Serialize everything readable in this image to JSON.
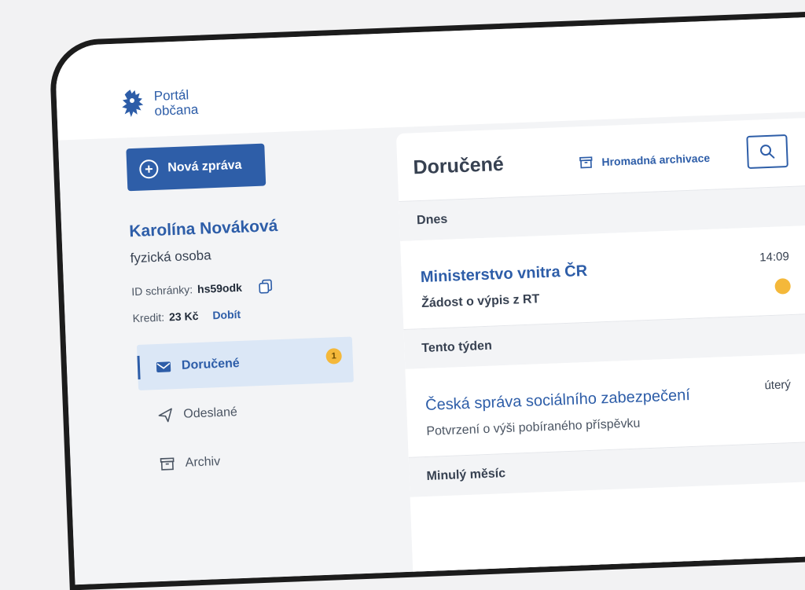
{
  "header": {
    "logo_line1": "Portál",
    "logo_line2": "občana"
  },
  "sidebar": {
    "new_message_label": "Nová zpráva",
    "user_name": "Karolína Nováková",
    "user_type": "fyzická osoba",
    "box_id_label": "ID schránky:",
    "box_id_value": "hs59odk",
    "credit_label": "Kredit:",
    "credit_value": "23 Kč",
    "topup_label": "Dobít",
    "nav": [
      {
        "label": "Doručené",
        "icon": "envelope-icon",
        "badge": "1"
      },
      {
        "label": "Odeslané",
        "icon": "send-icon"
      },
      {
        "label": "Archiv",
        "icon": "archive-icon"
      }
    ]
  },
  "inbox": {
    "title": "Doručené",
    "bulk_archive_label": "Hromadná archivace",
    "sections": [
      {
        "label": "Dnes",
        "messages": [
          {
            "sender": "Ministerstvo vnitra ČR",
            "subject": "Žádost o výpis z RT",
            "time": "14:09",
            "unread": true
          }
        ]
      },
      {
        "label": "Tento týden",
        "messages": [
          {
            "sender": "Česká správa sociálního zabezpečení",
            "subject": "Potvrzení o výši pobíraného příspěvku",
            "time": "úterý",
            "unread": false
          }
        ]
      },
      {
        "label": "Minulý měsíc",
        "messages": []
      }
    ]
  },
  "colors": {
    "brand": "#2d5da8",
    "unread_dot": "#f4b83a",
    "active_nav_bg": "#dbe7f6"
  }
}
